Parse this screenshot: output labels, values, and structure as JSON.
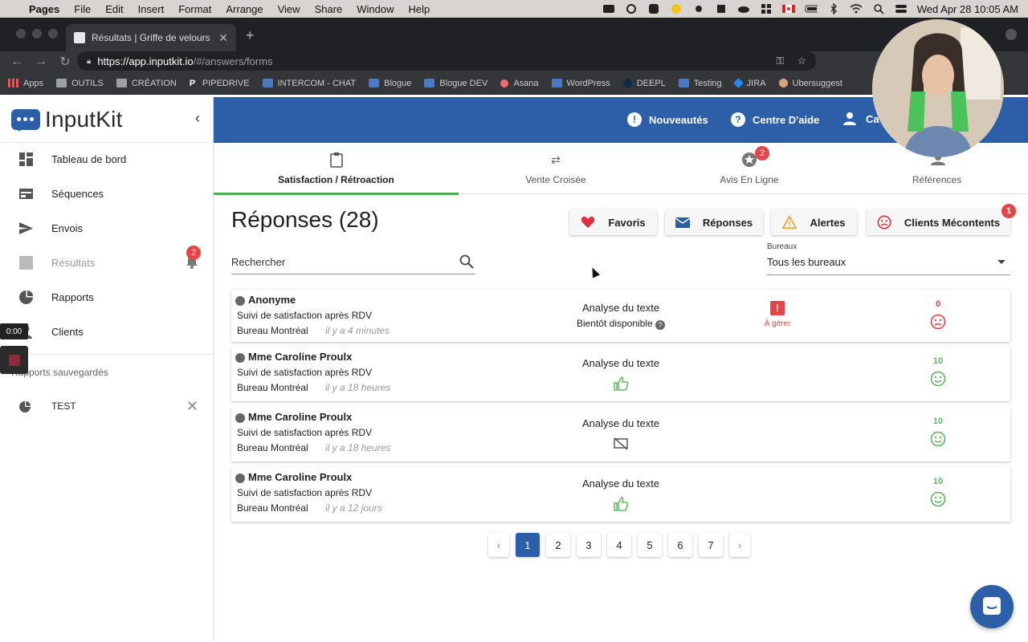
{
  "mac_menubar": {
    "app": "Pages",
    "menus": [
      "File",
      "Edit",
      "Insert",
      "Format",
      "Arrange",
      "View",
      "Share",
      "Window",
      "Help"
    ],
    "clock": "Wed Apr 28  10:05 AM"
  },
  "browser": {
    "tab_title": "Résultats | Griffe de velours | In",
    "url_host": "https://app.inputkit.io",
    "url_path": "/#/answers/forms",
    "bookmarks": [
      "Apps",
      "OUTILS",
      "CRÉATION",
      "PIPEDRIVE",
      "INTERCOM - CHAT",
      "Blogue",
      "Blogue DEV",
      "Asana",
      "WordPress",
      "DEEPL",
      "Testing",
      "JIRA",
      "Ubersuggest"
    ]
  },
  "sidebar": {
    "logo": "InputKit",
    "items": [
      {
        "label": "Tableau de bord",
        "icon": "dashboard-icon"
      },
      {
        "label": "Séquences",
        "icon": "sequences-icon"
      },
      {
        "label": "Envois",
        "icon": "send-icon"
      },
      {
        "label": "Résultats",
        "icon": "results-icon",
        "badge": "2"
      },
      {
        "label": "Rapports",
        "icon": "pie-chart-icon"
      },
      {
        "label": "Clients",
        "icon": "person-icon"
      }
    ],
    "saved_reports_title": "Rapports sauvegardés",
    "saved_reports": [
      {
        "label": "TEST"
      }
    ],
    "recorder_time": "0:00"
  },
  "topbar": {
    "news": "Nouveautés",
    "help": "Centre D'aide",
    "account": "Ca"
  },
  "tabs": [
    {
      "label": "Satisfaction / Rétroaction",
      "active": true
    },
    {
      "label": "Vente Croisée"
    },
    {
      "label": "Avis En Ligne",
      "badge": "2"
    },
    {
      "label": "Références"
    }
  ],
  "main": {
    "title": "Réponses (28)",
    "filters": [
      {
        "label": "Favoris",
        "icon": "heart-icon"
      },
      {
        "label": "Réponses",
        "icon": "mail-icon"
      },
      {
        "label": "Alertes",
        "icon": "warning-icon"
      },
      {
        "label": "Clients Mécontents",
        "icon": "sad-face-icon",
        "badge": "1"
      }
    ],
    "search_placeholder": "Rechercher",
    "office_label": "Bureaux",
    "office_value": "Tous les bureaux"
  },
  "responses": [
    {
      "name": "Anonyme",
      "sequence": "Suivi de satisfaction après RDV",
      "office": "Bureau Montréal",
      "time": "il y a 4 minutes",
      "analysis": "Analyse du texte",
      "analysis_sub": "Bientôt disponible",
      "alert": "À gérer",
      "score": "0",
      "sentiment": "negative"
    },
    {
      "name": "Mme Caroline Proulx",
      "sequence": "Suivi de satisfaction après RDV",
      "office": "Bureau Montréal",
      "time": "il y a 18 heures",
      "analysis": "Analyse du texte",
      "analysis_icon": "thumbs-up",
      "score": "10",
      "sentiment": "positive"
    },
    {
      "name": "Mme Caroline Proulx",
      "sequence": "Suivi de satisfaction après RDV",
      "office": "Bureau Montréal",
      "time": "il y a 18 heures",
      "analysis": "Analyse du texte",
      "analysis_icon": "no-comment",
      "score": "10",
      "sentiment": "positive"
    },
    {
      "name": "Mme Caroline Proulx",
      "sequence": "Suivi de satisfaction après RDV",
      "office": "Bureau Montréal",
      "time": "il y a 12 jours",
      "analysis": "Analyse du texte",
      "analysis_icon": "thumbs-up",
      "score": "10",
      "sentiment": "positive"
    }
  ],
  "pagination": {
    "pages": [
      "1",
      "2",
      "3",
      "4",
      "5",
      "6",
      "7"
    ],
    "current": "1"
  },
  "colors": {
    "brand": "#2d5fa8",
    "positive": "#5cb85c",
    "negative": "#e64545",
    "active_tab": "#4caf50"
  }
}
